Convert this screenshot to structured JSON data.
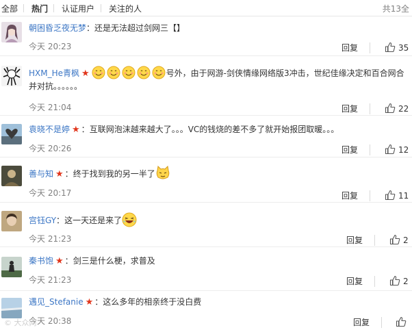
{
  "tabs": {
    "all": "全部",
    "hot": "热门",
    "verified": "认证用户",
    "following": "关注的人",
    "total": "共13全"
  },
  "comments": [
    {
      "user": "朝困昏乏夜无梦",
      "sep": "：",
      "text": "还是无法超过剑网三【】",
      "time": "今天 20:23",
      "reply": "回复",
      "likes": "35",
      "star": false
    },
    {
      "user": "HXM_He青枫",
      "sep": "",
      "text": "号外，由于网游-剑侠情缘网络版3冲击，世纪佳缘决定和百合网合并对抗。。。。。。",
      "time": "今天 21:04",
      "reply": "回复",
      "likes": "22",
      "star": true
    },
    {
      "user": "袁晓不是婷",
      "sep": "：",
      "text": "互联网泡沫越来越大了。。。VC的钱烧的差不多了就开始报团取暖。。。",
      "time": "今天 20:26",
      "reply": "回复",
      "likes": "12",
      "star": true
    },
    {
      "user": "善与知",
      "sep": "：",
      "text": "终于找到我的另一半了",
      "time": "今天 20:17",
      "reply": "回复",
      "likes": "11",
      "star": true
    },
    {
      "user": "宫钰GY",
      "sep": "：",
      "text": "这一天还是来了",
      "time": "今天 21:23",
      "reply": "回复",
      "likes": "2",
      "star": false
    },
    {
      "user": "秦书饱",
      "sep": "：",
      "text": "剑三是什么梗，求普及",
      "time": "今天 21:23",
      "reply": "回复",
      "likes": "2",
      "star": true
    },
    {
      "user": "遇见_Stefanie",
      "sep": "：",
      "text": "这么多年的相亲终于没白费",
      "time": "今天 20:38",
      "reply": "回复",
      "likes": "",
      "star": true
    }
  ],
  "watermark": "© 大众网",
  "colors": {
    "link": "#3d77c5",
    "star": "#e1361c",
    "muted": "#808080"
  }
}
